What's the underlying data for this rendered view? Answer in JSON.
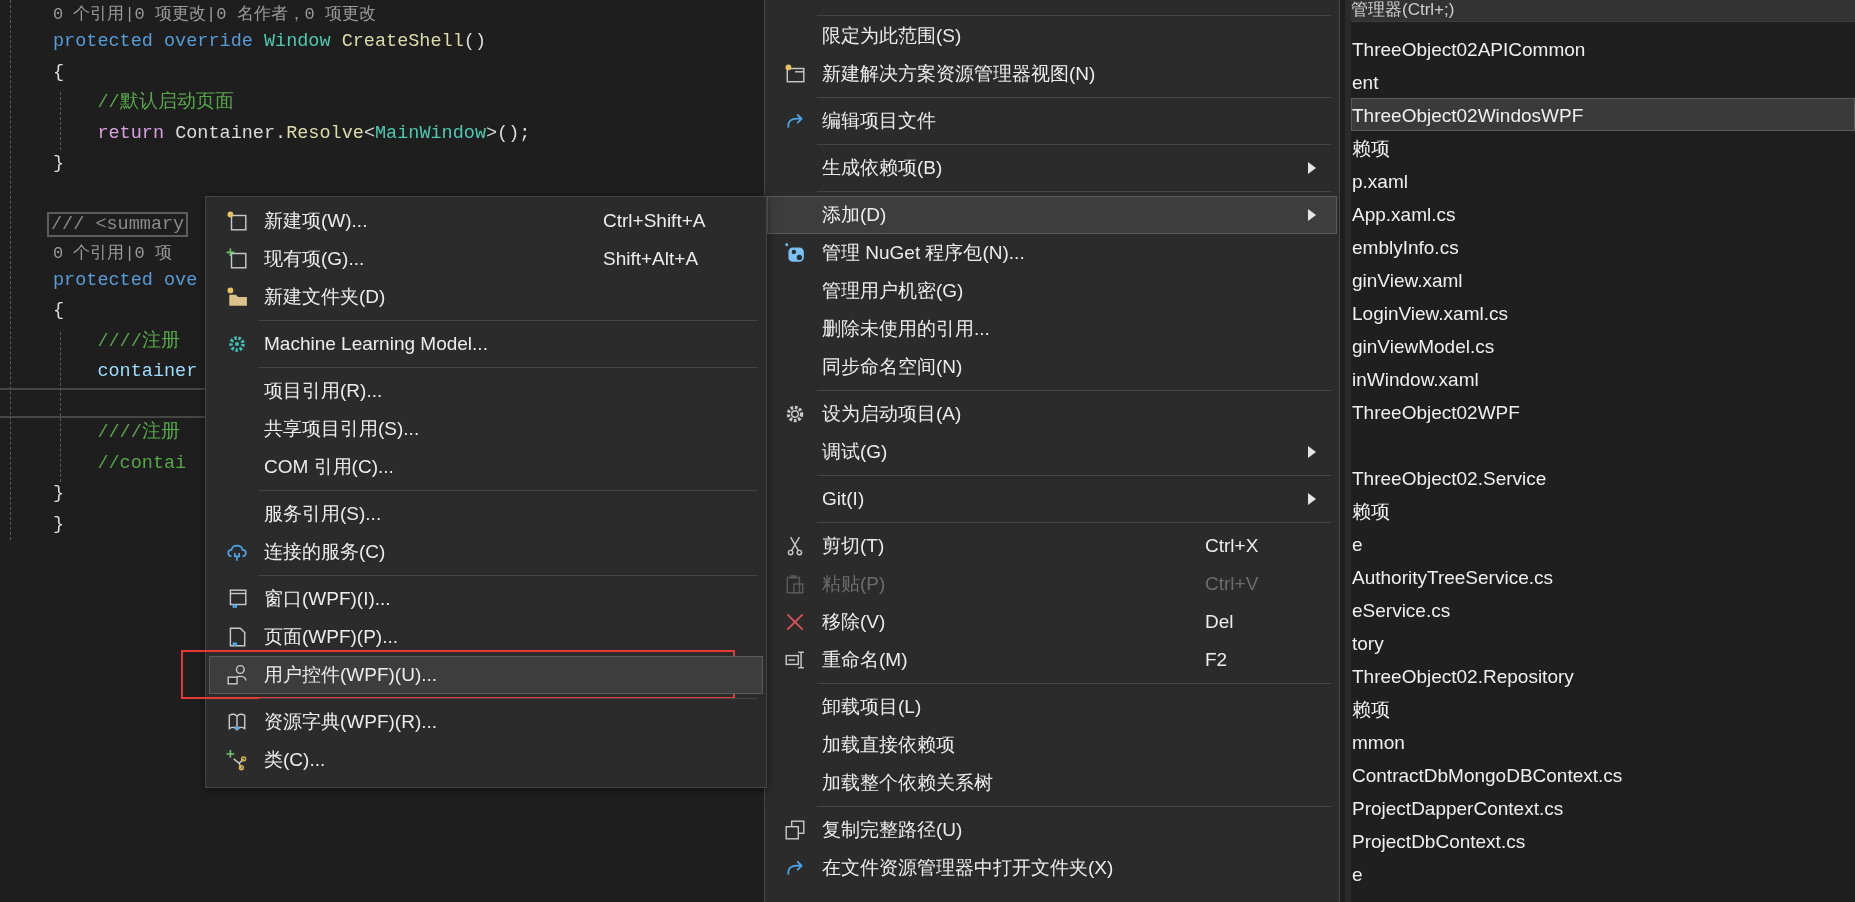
{
  "editor": {
    "lines": [
      {
        "kind": "lens",
        "current": false,
        "segments": [
          {
            "kind": "lens",
            "text": "0 个引用|0 项更改|0 名作者，0 项更改"
          }
        ]
      },
      {
        "kind": "code",
        "current": false,
        "segments": [
          {
            "kind": "keyword",
            "text": "protected override "
          },
          {
            "kind": "type",
            "text": "Window "
          },
          {
            "kind": "method",
            "text": "CreateShell"
          },
          {
            "kind": "plain",
            "text": "()"
          }
        ]
      },
      {
        "kind": "code",
        "current": false,
        "segments": [
          {
            "kind": "plain",
            "text": "{"
          }
        ]
      },
      {
        "kind": "code",
        "current": false,
        "segments": [
          {
            "kind": "comment",
            "text": "    //默认启动页面"
          }
        ]
      },
      {
        "kind": "code",
        "current": false,
        "segments": [
          {
            "kind": "control",
            "text": "    return "
          },
          {
            "kind": "plain",
            "text": "Container."
          },
          {
            "kind": "method",
            "text": "Resolve"
          },
          {
            "kind": "plain",
            "text": "<"
          },
          {
            "kind": "type",
            "text": "MainWindow"
          },
          {
            "kind": "plain",
            "text": ">();"
          }
        ]
      },
      {
        "kind": "code",
        "current": false,
        "segments": [
          {
            "kind": "plain",
            "text": "}"
          }
        ]
      },
      {
        "kind": "blank",
        "current": false
      },
      {
        "kind": "code",
        "current": false,
        "segments": [
          {
            "kind": "collapsed",
            "text": "/// <summary"
          }
        ]
      },
      {
        "kind": "lens",
        "current": false,
        "segments": [
          {
            "kind": "lens",
            "text": "0 个引用|0 项"
          }
        ]
      },
      {
        "kind": "code",
        "current": false,
        "segments": [
          {
            "kind": "keyword",
            "text": "protected ove"
          }
        ]
      },
      {
        "kind": "code",
        "current": false,
        "segments": [
          {
            "kind": "plain",
            "text": "{"
          }
        ]
      },
      {
        "kind": "code",
        "current": false,
        "segments": [
          {
            "kind": "comment",
            "text": "    ////注册"
          }
        ]
      },
      {
        "kind": "code",
        "current": false,
        "segments": [
          {
            "kind": "variable",
            "text": "    container"
          }
        ]
      },
      {
        "kind": "blank",
        "current": true
      },
      {
        "kind": "code",
        "current": false,
        "segments": [
          {
            "kind": "comment",
            "text": "    ////注册"
          }
        ]
      },
      {
        "kind": "code",
        "current": false,
        "segments": [
          {
            "kind": "comment",
            "text": "    //contai"
          }
        ]
      },
      {
        "kind": "code",
        "current": false,
        "segments": [
          {
            "kind": "plain",
            "text": "}"
          }
        ]
      },
      {
        "kind": "code",
        "current": false,
        "segments": [
          {
            "kind": "plain",
            "text": "}"
          }
        ]
      }
    ]
  },
  "context_menu": {
    "groups": [
      {
        "items": [
          {
            "label": "限定为此范围(S)",
            "selected": false,
            "disabled": false,
            "has_submenu": false
          },
          {
            "label": "新建解决方案资源管理器视图(N)",
            "selected": false,
            "disabled": false,
            "has_submenu": false
          }
        ]
      },
      {
        "items": [
          {
            "label": "编辑项目文件",
            "selected": false,
            "disabled": false,
            "has_submenu": false
          }
        ]
      },
      {
        "items": [
          {
            "label": "生成依赖项(B)",
            "selected": false,
            "disabled": false,
            "has_submenu": true
          }
        ]
      },
      {
        "items": [
          {
            "label": "添加(D)",
            "selected": true,
            "disabled": false,
            "has_submenu": true
          },
          {
            "label": "管理 NuGet 程序包(N)...",
            "selected": false,
            "disabled": false,
            "has_submenu": false
          },
          {
            "label": "管理用户机密(G)",
            "selected": false,
            "disabled": false,
            "has_submenu": false
          },
          {
            "label": "删除未使用的引用...",
            "selected": false,
            "disabled": false,
            "has_submenu": false
          },
          {
            "label": "同步命名空间(N)",
            "selected": false,
            "disabled": false,
            "has_submenu": false
          }
        ]
      },
      {
        "items": [
          {
            "label": "设为启动项目(A)",
            "selected": false,
            "disabled": false,
            "has_submenu": false
          },
          {
            "label": "调试(G)",
            "selected": false,
            "disabled": false,
            "has_submenu": true
          }
        ]
      },
      {
        "items": [
          {
            "label": "Git(I)",
            "selected": false,
            "disabled": false,
            "has_submenu": true
          }
        ]
      },
      {
        "items": [
          {
            "label": "剪切(T)",
            "shortcut": "Ctrl+X",
            "selected": false,
            "disabled": false,
            "has_submenu": false
          },
          {
            "label": "粘贴(P)",
            "shortcut": "Ctrl+V",
            "selected": false,
            "disabled": true,
            "has_submenu": false
          },
          {
            "label": "移除(V)",
            "shortcut": "Del",
            "selected": false,
            "disabled": false,
            "has_submenu": false
          },
          {
            "label": "重命名(M)",
            "shortcut": "F2",
            "selected": false,
            "disabled": false,
            "has_submenu": false
          }
        ]
      },
      {
        "items": [
          {
            "label": "卸载项目(L)",
            "selected": false,
            "disabled": false,
            "has_submenu": false
          },
          {
            "label": "加载直接依赖项",
            "selected": false,
            "disabled": false,
            "has_submenu": false
          },
          {
            "label": "加载整个依赖关系树",
            "selected": false,
            "disabled": false,
            "has_submenu": false
          }
        ]
      },
      {
        "items": [
          {
            "label": "复制完整路径(U)",
            "selected": false,
            "disabled": false,
            "has_submenu": false
          },
          {
            "label": "在文件资源管理器中打开文件夹(X)",
            "selected": false,
            "disabled": false,
            "has_submenu": false
          }
        ]
      }
    ]
  },
  "add_submenu": {
    "groups": [
      {
        "items": [
          {
            "label": "新建项(W)...",
            "shortcut": "Ctrl+Shift+A",
            "selected": false,
            "outlined": false
          },
          {
            "label": "现有项(G)...",
            "shortcut": "Shift+Alt+A",
            "selected": false,
            "outlined": false
          },
          {
            "label": "新建文件夹(D)",
            "selected": false,
            "outlined": false
          }
        ]
      },
      {
        "items": [
          {
            "label": "Machine Learning Model...",
            "selected": false,
            "outlined": false
          }
        ]
      },
      {
        "items": [
          {
            "label": "项目引用(R)...",
            "selected": false,
            "outlined": false
          },
          {
            "label": "共享项目引用(S)...",
            "selected": false,
            "outlined": false
          },
          {
            "label": "COM 引用(C)...",
            "selected": false,
            "outlined": false
          }
        ]
      },
      {
        "items": [
          {
            "label": "服务引用(S)...",
            "selected": false,
            "outlined": false
          },
          {
            "label": "连接的服务(C)",
            "selected": false,
            "outlined": false
          }
        ]
      },
      {
        "items": [
          {
            "label": "窗口(WPF)(I)...",
            "selected": false,
            "outlined": false
          },
          {
            "label": "页面(WPF)(P)...",
            "selected": false,
            "outlined": false
          },
          {
            "label": "用户控件(WPF)(U)...",
            "selected": true,
            "outlined": true
          }
        ]
      },
      {
        "items": [
          {
            "label": "资源字典(WPF)(R)...",
            "selected": false,
            "outlined": false
          },
          {
            "label": "类(C)...",
            "selected": false,
            "outlined": false
          }
        ]
      }
    ]
  },
  "solution_explorer": {
    "search": {
      "placeholder": "管理器(Ctrl+;)"
    },
    "rows": [
      {
        "label": "ThreeObject02APICommon",
        "selected": false
      },
      {
        "label": "ent",
        "selected": false
      },
      {
        "label": "ThreeObject02WindosWPF",
        "selected": true
      },
      {
        "label": "赖项",
        "selected": false
      },
      {
        "label": "p.xaml",
        "selected": false
      },
      {
        "label": "App.xaml.cs",
        "selected": false
      },
      {
        "label": "emblyInfo.cs",
        "selected": false
      },
      {
        "label": "ginView.xaml",
        "selected": false
      },
      {
        "label": "LoginView.xaml.cs",
        "selected": false
      },
      {
        "label": "ginViewModel.cs",
        "selected": false
      },
      {
        "label": "inWindow.xaml",
        "selected": false
      },
      {
        "label": "ThreeObject02WPF",
        "selected": false
      },
      {
        "selected": false
      },
      {
        "label": "ThreeObject02.Service",
        "selected": false
      },
      {
        "label": "赖项",
        "selected": false
      },
      {
        "label": "e",
        "selected": false
      },
      {
        "label": "AuthorityTreeService.cs",
        "selected": false
      },
      {
        "label": "eService.cs",
        "selected": false
      },
      {
        "label": "tory",
        "selected": false
      },
      {
        "label": "ThreeObject02.Repository",
        "selected": false
      },
      {
        "label": "赖项",
        "selected": false
      },
      {
        "label": "mmon",
        "selected": false
      },
      {
        "label": "ContractDbMongoDBContext.cs",
        "selected": false
      },
      {
        "label": "ProjectDapperContext.cs",
        "selected": false
      },
      {
        "label": "ProjectDbContext.cs",
        "selected": false
      },
      {
        "label": "e",
        "selected": false
      }
    ]
  }
}
